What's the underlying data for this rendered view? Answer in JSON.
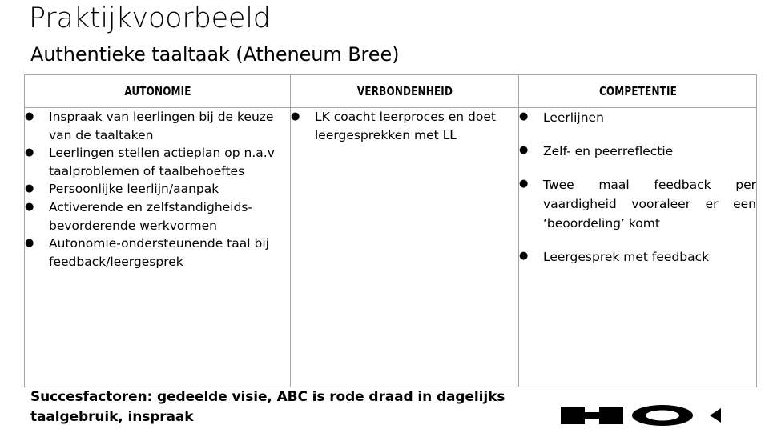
{
  "slide": {
    "title": "Praktijkvoorbeeld",
    "subtitle": "Authentieke taaltaak (Atheneum Bree)",
    "caption": "Succesfactoren: gedeelde visie, ABC is rode draad in dagelijks taalgebruik, inspraak"
  },
  "table": {
    "headers": [
      "AUTONOMIE",
      "VERBONDENHEID",
      "COMPETENTIE"
    ],
    "columns": [
      {
        "header": "AUTONOMIE",
        "bullets": [
          "Inspraak van leerlingen bij de keuze van de taaltaken",
          "Leerlingen stellen actieplan op n.a.v taalproblemen of taalbehoeftes",
          "Persoonlijke leerlijn/aanpak",
          "Activerende en zelfstandigheids- bevorderende werkvormen",
          "Autonomie-ondersteunende taal bij feedback/leergesprek"
        ]
      },
      {
        "header": "VERBONDENHEID",
        "bullets": [
          "LK coacht leerproces en doet leergesprekken met LL"
        ]
      },
      {
        "header": "COMPETENTIE",
        "bullets": [
          "Leerlijnen",
          "Zelf- en peerreflectie",
          "Twee maal feedback per vaardigheid vooraleer er een ‘beoordeling’ komt",
          "Leergesprek met feedback"
        ]
      }
    ]
  },
  "bullet_glyph": "●",
  "decoration": {
    "shapes": [
      "dumbbell-shape",
      "ellipse-ring-shape",
      "triangle-left-shape"
    ],
    "color": "#000000"
  },
  "colors": {
    "text": "#000000",
    "table_border": "#a6a6a6",
    "background": "#ffffff"
  }
}
